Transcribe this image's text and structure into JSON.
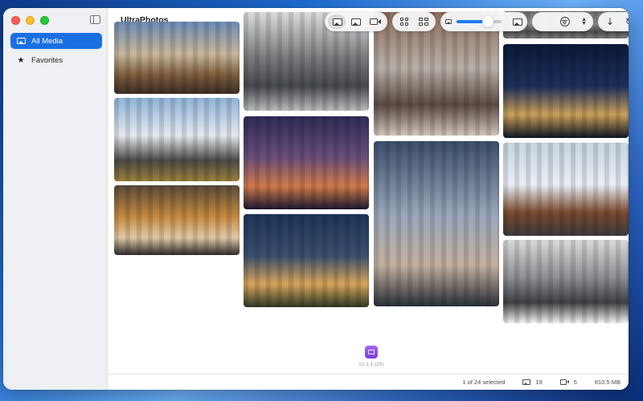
{
  "app": {
    "title": "UltraPhotos"
  },
  "sidebar": {
    "items": [
      {
        "label": "All Media",
        "icon": "photo-library-icon",
        "active": true
      },
      {
        "label": "Favorites",
        "icon": "star-icon",
        "active": false
      }
    ]
  },
  "toolbar": {
    "media_filter": [
      "all-media-icon",
      "photos-icon",
      "videos-icon"
    ],
    "layout": [
      "grid-small-icon",
      "grid-large-icon"
    ],
    "zoom": {
      "min_icon": "photo-small-icon",
      "max_icon": "photo-large-icon",
      "level": 0.7
    },
    "sort_select": {
      "icon": "filter-icon"
    },
    "actions": [
      "download-icon",
      "refresh-icon"
    ]
  },
  "gallery": {
    "columns": [
      {
        "tiles": [
          {
            "name": "city-skyline-sunset",
            "colors": [
              "#6d8bb5",
              "#c7b79c",
              "#7a5a3a",
              "#3b2e24"
            ]
          },
          {
            "name": "snowy-mountain",
            "colors": [
              "#8fb3d9",
              "#e4e8ee",
              "#4b4a47",
              "#9a7f3a"
            ]
          },
          {
            "name": "glass-towers-looking-up",
            "colors": [
              "#5a4a3a",
              "#c58a3f",
              "#e0c8a6",
              "#2f2c2a"
            ]
          }
        ]
      },
      {
        "tiles": [
          {
            "name": "city-street-grayscale",
            "colors": [
              "#dcdcdc",
              "#7b7d80",
              "#45484c",
              "#b9bbbe"
            ]
          },
          {
            "name": "purple-dusk-cityscape",
            "colors": [
              "#2f2b57",
              "#6b4f7a",
              "#d07a4a",
              "#1b1830"
            ]
          },
          {
            "name": "house-at-night",
            "colors": [
              "#1d3558",
              "#3b4f6e",
              "#d8a45a",
              "#2e3a24"
            ]
          }
        ]
      },
      {
        "tiles": [
          {
            "name": "dense-skyscrapers-aerial",
            "colors": [
              "#8d6a5a",
              "#b7b0a8",
              "#5b4a44",
              "#cfc5bb"
            ]
          },
          {
            "name": "downtown-street-traffic",
            "colors": [
              "#3b4e6a",
              "#9aa7bb",
              "#c3b0a0",
              "#2a2f38"
            ]
          }
        ]
      },
      {
        "tiles": [
          {
            "name": "top-partial-image",
            "colors": [
              "#6a6c70",
              "#9a9ca0",
              "#4a4c50",
              "#7a7c80"
            ]
          },
          {
            "name": "city-lights-night",
            "colors": [
              "#0b1a3a",
              "#1d2f5a",
              "#caa15a",
              "#0e1426"
            ]
          },
          {
            "name": "balconies-building",
            "colors": [
              "#c8d4e0",
              "#e8eef4",
              "#7a4a2e",
              "#3a3a3c"
            ]
          },
          {
            "name": "abstract-architecture",
            "colors": [
              "#d9dadc",
              "#8d8f93",
              "#3e4043",
              "#f2f2f3"
            ]
          }
        ]
      }
    ]
  },
  "footer": {
    "version": "v1.1.1 (26)"
  },
  "status": {
    "selection": "1 of 24 selected",
    "photo_count": "19",
    "video_count": "5",
    "total_size": "810.5 MB"
  }
}
